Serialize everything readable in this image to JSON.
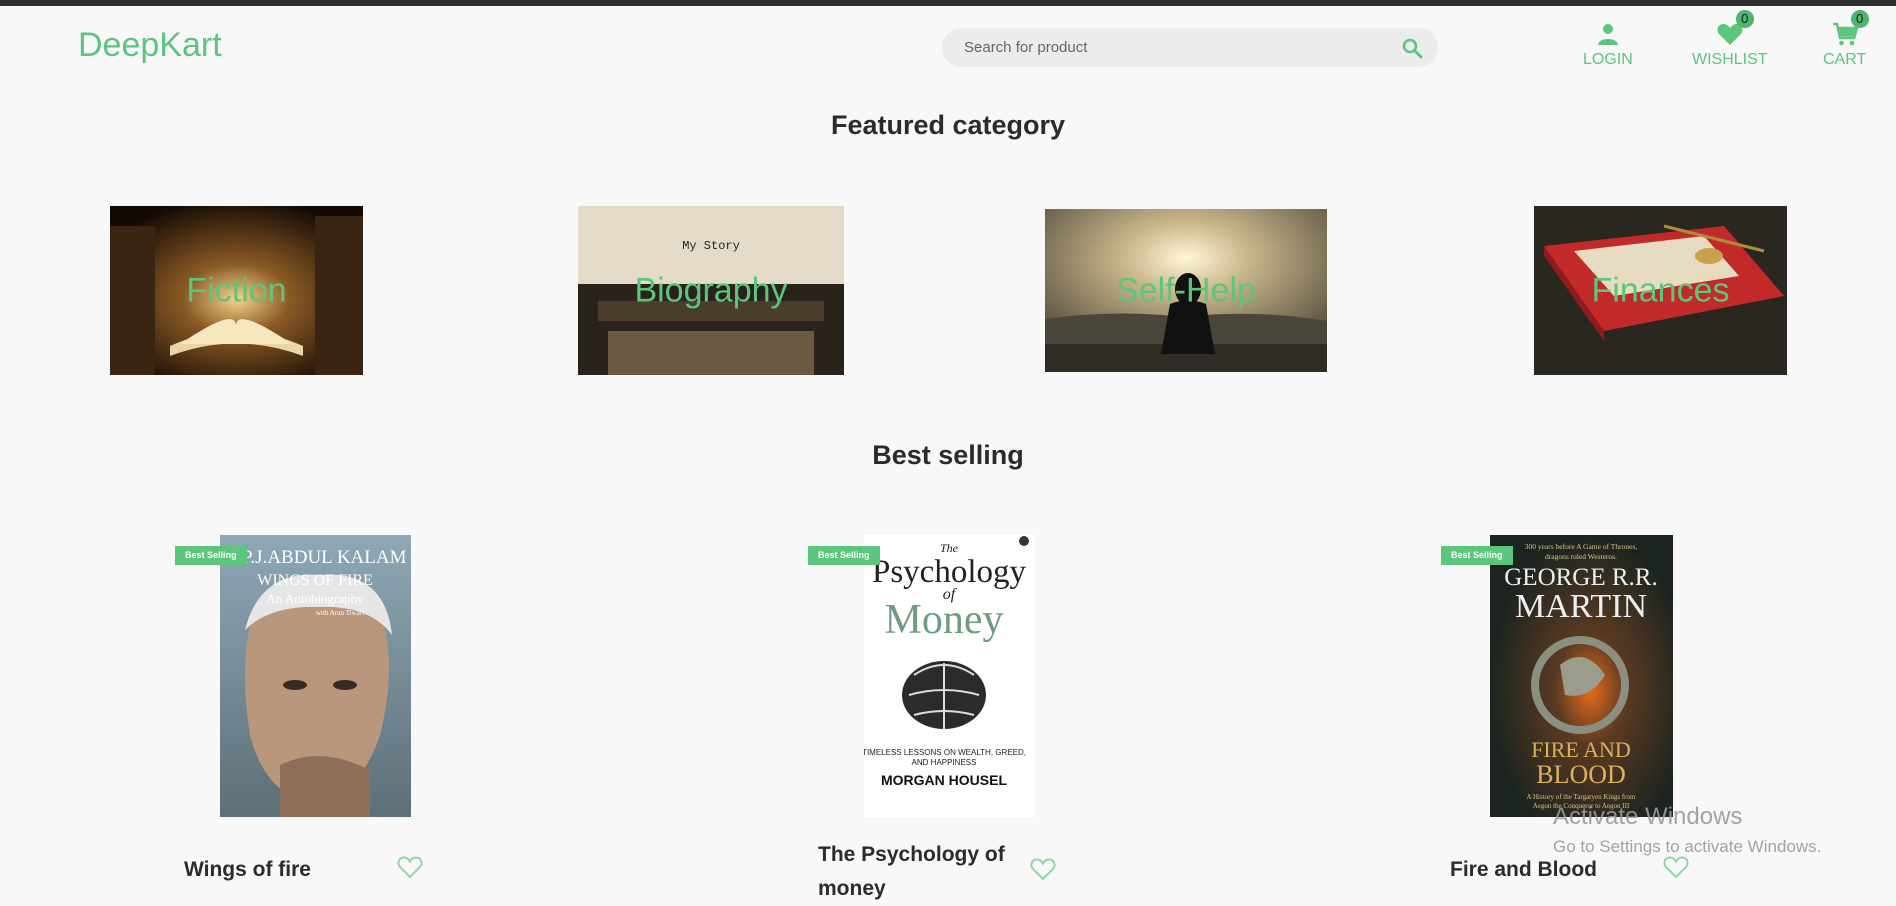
{
  "header": {
    "logo": "DeepKart",
    "search_placeholder": "Search for product",
    "nav": {
      "login": "LOGIN",
      "wishlist": "WISHLIST",
      "wishlist_count": "0",
      "cart": "CART",
      "cart_count": "0"
    }
  },
  "featured": {
    "title": "Featured category",
    "categories": [
      {
        "label": "Fiction"
      },
      {
        "label": "Biography",
        "image_text": "My Story"
      },
      {
        "label": "Self-Help"
      },
      {
        "label": "Finances"
      }
    ]
  },
  "best_selling": {
    "title": "Best selling",
    "tag": "Best Selling",
    "books": [
      {
        "title": "Wings of fire",
        "cover": {
          "line1": "A.P.J.ABDUL KALAM",
          "line2": "WINGS OF FIRE",
          "line3": "An Autobiography",
          "line4": "with Arun Tiwari"
        }
      },
      {
        "title": "The Psychology of money",
        "cover": {
          "line1": "The",
          "line2": "Psychology",
          "line3": "of",
          "line4": "Money",
          "line5": "TIMELESS LESSONS ON WEALTH, GREED,",
          "line6": "AND HAPPINESS",
          "line7": "MORGAN HOUSEL"
        }
      },
      {
        "title": "Fire and Blood",
        "cover": {
          "line1": "300 years before A Game of Thrones,",
          "line2": "dragons ruled Westeros.",
          "line3": "GEORGE R.R.",
          "line4": "MARTIN",
          "line5": "FIRE AND",
          "line6": "BLOOD",
          "line7": "A History of the Targaryen Kings from",
          "line8": "Aegon the Conqueror to Aegon III"
        }
      }
    ]
  },
  "watermark": {
    "title": "Activate Windows",
    "subtitle": "Go to Settings to activate Windows."
  },
  "colors": {
    "accent": "#5cc57e",
    "background": "#f8f8f8",
    "text": "#2b2b2b"
  }
}
